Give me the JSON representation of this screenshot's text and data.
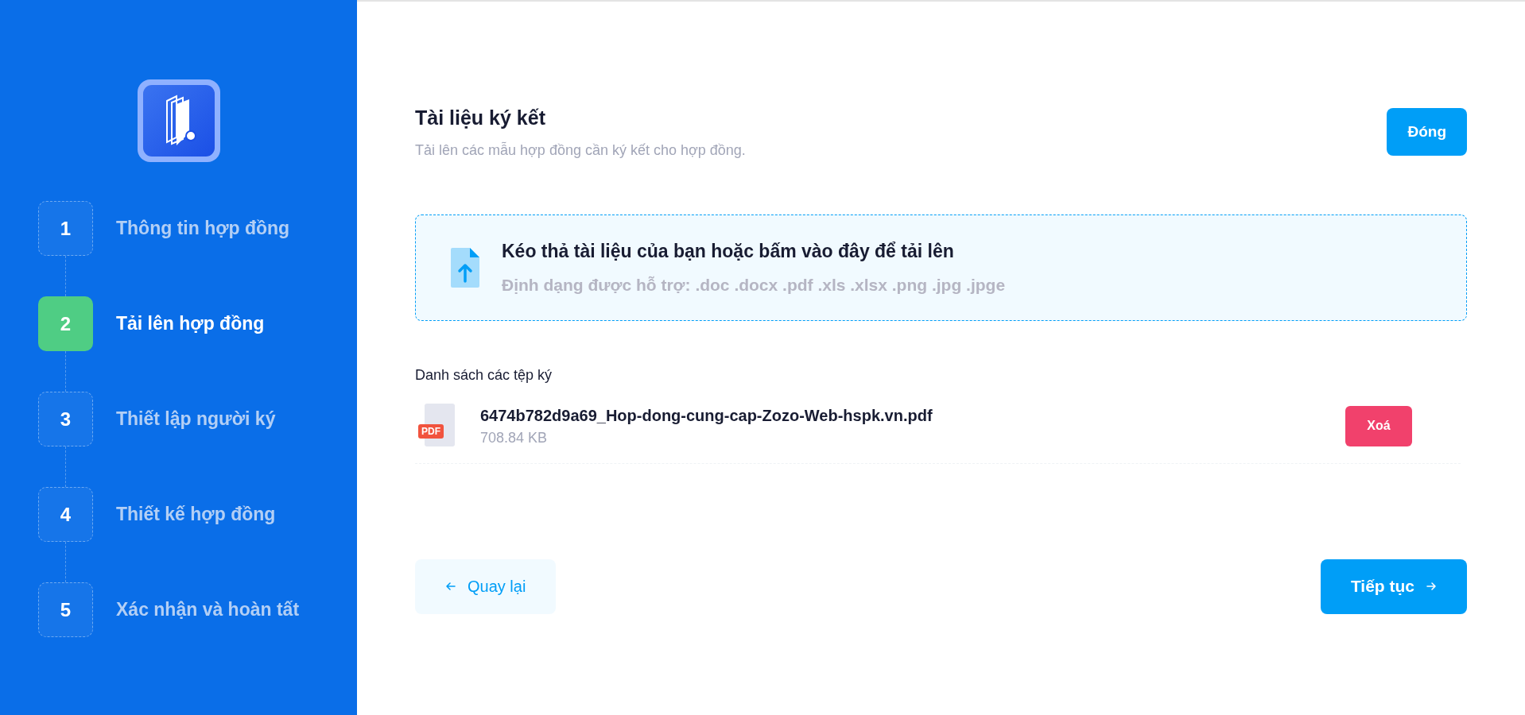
{
  "steps": [
    {
      "number": "1",
      "label": "Thông tin hợp đồng",
      "selected": false
    },
    {
      "number": "2",
      "label": "Tải lên hợp đồng",
      "selected": true
    },
    {
      "number": "3",
      "label": "Thiết lập người ký",
      "selected": false
    },
    {
      "number": "4",
      "label": "Thiết kế hợp đồng",
      "selected": false
    },
    {
      "number": "5",
      "label": "Xác nhận và hoàn tất",
      "selected": false
    }
  ],
  "header": {
    "title": "Tài liệu ký kết",
    "subtitle": "Tải lên các mẫu hợp đồng cần ký kết cho hợp đồng.",
    "close_button": "Đóng"
  },
  "upload": {
    "title": "Kéo thả tài liệu của bạn hoặc bấm vào đây để tải lên",
    "formats": "Định dạng được hỗ trợ: .doc .docx .pdf .xls .xlsx .png .jpg .jpge"
  },
  "files": {
    "heading": "Danh sách các tệp ký",
    "items": [
      {
        "file_type": "PDF",
        "name": "6474b782d9a69_Hop-dong-cung-cap-Zozo-Web-hspk.vn.pdf",
        "size": "708.84 KB",
        "delete_button": "Xoá"
      }
    ]
  },
  "footer": {
    "back_button": "Quay lại",
    "next_button": "Tiếp tục"
  }
}
